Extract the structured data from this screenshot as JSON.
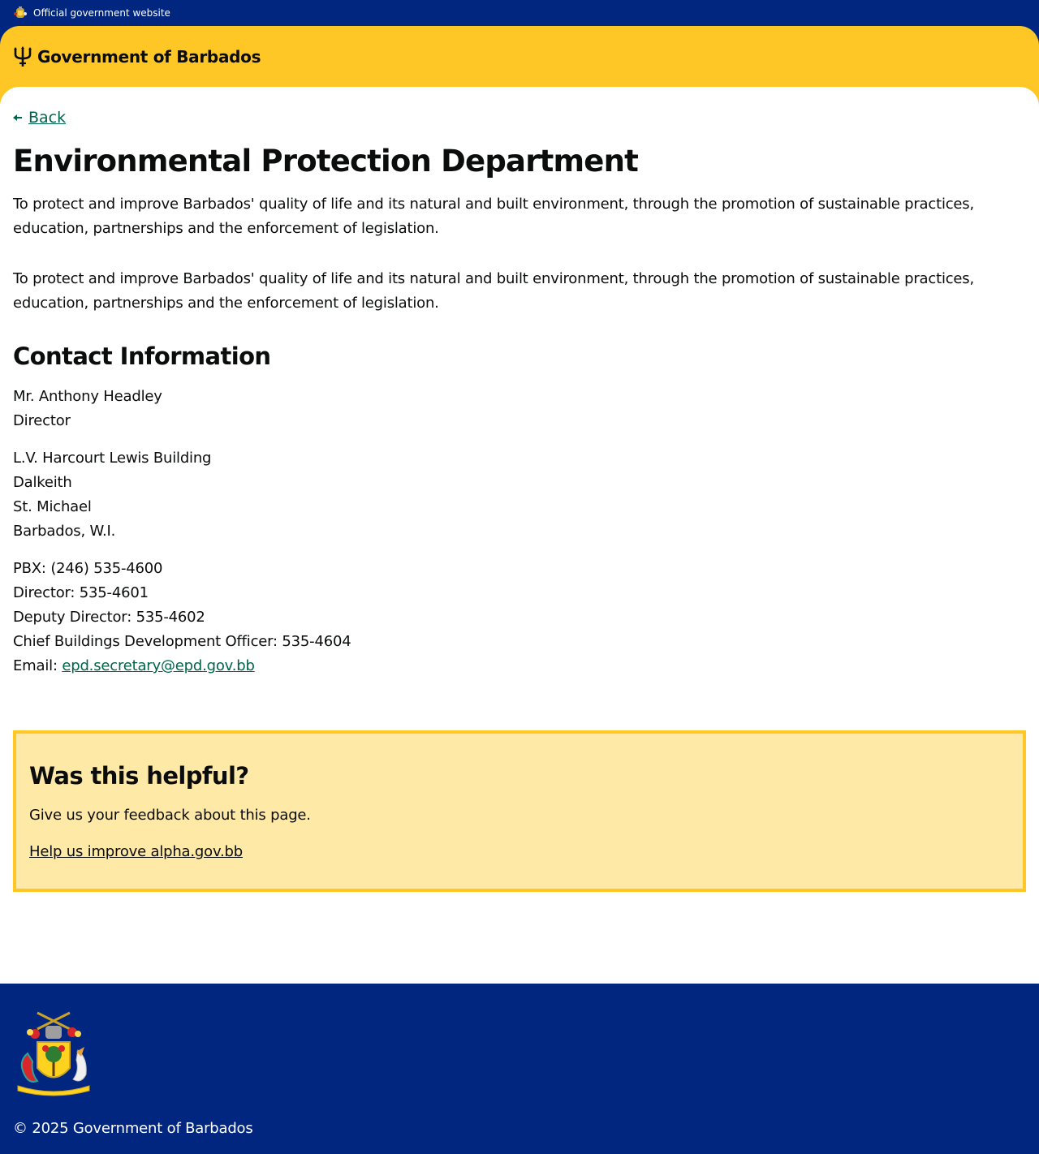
{
  "official_bar": {
    "text": "Official government website",
    "icon": "crest-icon"
  },
  "header": {
    "brand_name": "Government of Barbados",
    "icon": "trident-icon"
  },
  "nav": {
    "back_label": "Back"
  },
  "main": {
    "title": "Environmental Protection Department",
    "paragraphs": [
      "To protect and improve Barbados' quality of life and its natural and built environment, through the promotion of sustainable practices, education, partnerships and the enforcement of legislation.",
      "To protect and improve Barbados' quality of life and its natural and built environment, through the promotion of sustainable practices, education, partnerships and the enforcement of legislation."
    ],
    "contact": {
      "heading": "Contact Information",
      "person": [
        "Mr. Anthony Headley",
        "Director"
      ],
      "address": [
        "L.V. Harcourt Lewis Building",
        "Dalkeith",
        "St. Michael",
        "Barbados, W.I."
      ],
      "phones": [
        "PBX: (246) 535-4600",
        "Director: 535-4601",
        "Deputy Director: 535-4602",
        "Chief Buildings Development Officer: 535-4604"
      ],
      "email_label": "Email:",
      "email": "epd.secretary@epd.gov.bb"
    }
  },
  "feedback": {
    "title": "Was this helpful?",
    "text": "Give us your feedback about this page.",
    "link_label": "Help us improve alpha.gov.bb"
  },
  "footer": {
    "copyright": "© 2025 Government of Barbados",
    "icon": "coat-of-arms-icon"
  },
  "colors": {
    "navy": "#00267f",
    "gold": "#ffc726",
    "feedback_bg": "#ffe9a6",
    "link_green": "#00654a"
  }
}
